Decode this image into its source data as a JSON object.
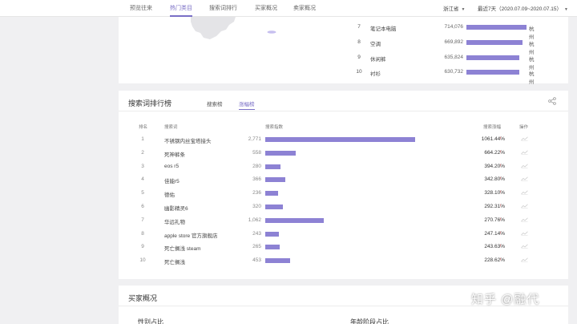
{
  "nav": {
    "items": [
      {
        "label": "预览往来"
      },
      {
        "label": "热门类目"
      },
      {
        "label": "搜索词排行"
      },
      {
        "label": "买家概况"
      },
      {
        "label": "卖家概况"
      }
    ],
    "active_index": 1,
    "region": "浙江省",
    "range": "最近7天（2020.07.09~2020.07.15）"
  },
  "regions": {
    "rows": [
      {
        "rank": "7",
        "name": "笔记本电脑",
        "value": "714,076",
        "bar": 0.475,
        "city": "杭州"
      },
      {
        "rank": "8",
        "name": "空调",
        "value": "669,892",
        "bar": 0.445,
        "city": "杭州"
      },
      {
        "rank": "9",
        "name": "休闲裤",
        "value": "635,824",
        "bar": 0.42,
        "city": "杭州"
      },
      {
        "rank": "10",
        "name": "衬衫",
        "value": "630,732",
        "bar": 0.415,
        "city": "杭州"
      }
    ]
  },
  "search": {
    "title": "搜索词排行榜",
    "tabs": [
      "搜索榜",
      "涨幅榜"
    ],
    "active_tab": 1,
    "headers": {
      "rank": "排名",
      "keyword": "搜索词",
      "index": "搜索指数",
      "growth": "搜索涨幅",
      "op": "操作"
    },
    "rows": [
      {
        "rank": "1",
        "keyword": "不锈钢内丝宝塔接头",
        "index": "2,771",
        "bar": 1.0,
        "growth": "1061.44%"
      },
      {
        "rank": "2",
        "keyword": "死神裤条",
        "index": "558",
        "bar": 0.205,
        "growth": "664.22%"
      },
      {
        "rank": "3",
        "keyword": "eos r5",
        "index": "280",
        "bar": 0.103,
        "growth": "394.20%"
      },
      {
        "rank": "4",
        "keyword": "佳能r5",
        "index": "366",
        "bar": 0.135,
        "growth": "342.80%"
      },
      {
        "rank": "5",
        "keyword": "德佑",
        "index": "236",
        "bar": 0.087,
        "growth": "328.10%"
      },
      {
        "rank": "6",
        "keyword": "幽影精灵6",
        "index": "320",
        "bar": 0.118,
        "growth": "292.31%"
      },
      {
        "rank": "7",
        "keyword": "华远礼物",
        "index": "1,062",
        "bar": 0.39,
        "growth": "270.76%"
      },
      {
        "rank": "8",
        "keyword": "apple store 官方旗舰店",
        "index": "243",
        "bar": 0.09,
        "growth": "247.14%"
      },
      {
        "rank": "9",
        "keyword": "死亡搁浅 steam",
        "index": "265",
        "bar": 0.098,
        "growth": "243.63%"
      },
      {
        "rank": "10",
        "keyword": "死亡搁浅",
        "index": "453",
        "bar": 0.167,
        "growth": "228.62%"
      }
    ],
    "up_arrow": "↑"
  },
  "buyers": {
    "title": "买家概况",
    "sub_left": "性别占比",
    "sub_right": "年龄阶段占比"
  },
  "watermark": "知乎 @融代",
  "colors": {
    "accent": "#7a6fc6",
    "bar": "#8d82d4",
    "up": "#d43a3a"
  },
  "icons": {
    "share": "share-icon",
    "operation": "trend-icon"
  }
}
